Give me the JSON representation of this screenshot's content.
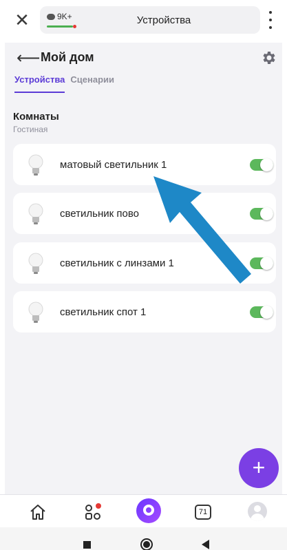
{
  "topbar": {
    "chat_count": "9K+",
    "title": "Устройства"
  },
  "header": {
    "title": "Мой дом"
  },
  "tabs": [
    {
      "label": "Устройства",
      "active": true
    },
    {
      "label": "Сценарии",
      "active": false
    }
  ],
  "section": {
    "title": "Комнаты",
    "room": "Гостиная"
  },
  "devices": [
    {
      "name": "матовый светильник 1",
      "on": true
    },
    {
      "name": "светильник пово",
      "on": true
    },
    {
      "name": "светильник с линзами 1",
      "on": true
    },
    {
      "name": "светильник спот 1",
      "on": true
    }
  ],
  "fab": {
    "label": "+"
  },
  "bottomnav": {
    "calendar_day": "71"
  },
  "colors": {
    "accent": "#5b3bd6",
    "toggle_on": "#5cb85c",
    "fab": "#7b3fe4",
    "annotation_arrow": "#1e88c7"
  },
  "icons": {
    "close": "close-icon",
    "menu": "kebab-menu-icon",
    "back": "arrow-left-icon",
    "settings": "gear-icon",
    "device": "lightbulb-icon",
    "home": "home-icon",
    "services": "grid-icon",
    "alice": "alice-icon",
    "calendar": "calendar-icon",
    "profile": "avatar-icon"
  }
}
